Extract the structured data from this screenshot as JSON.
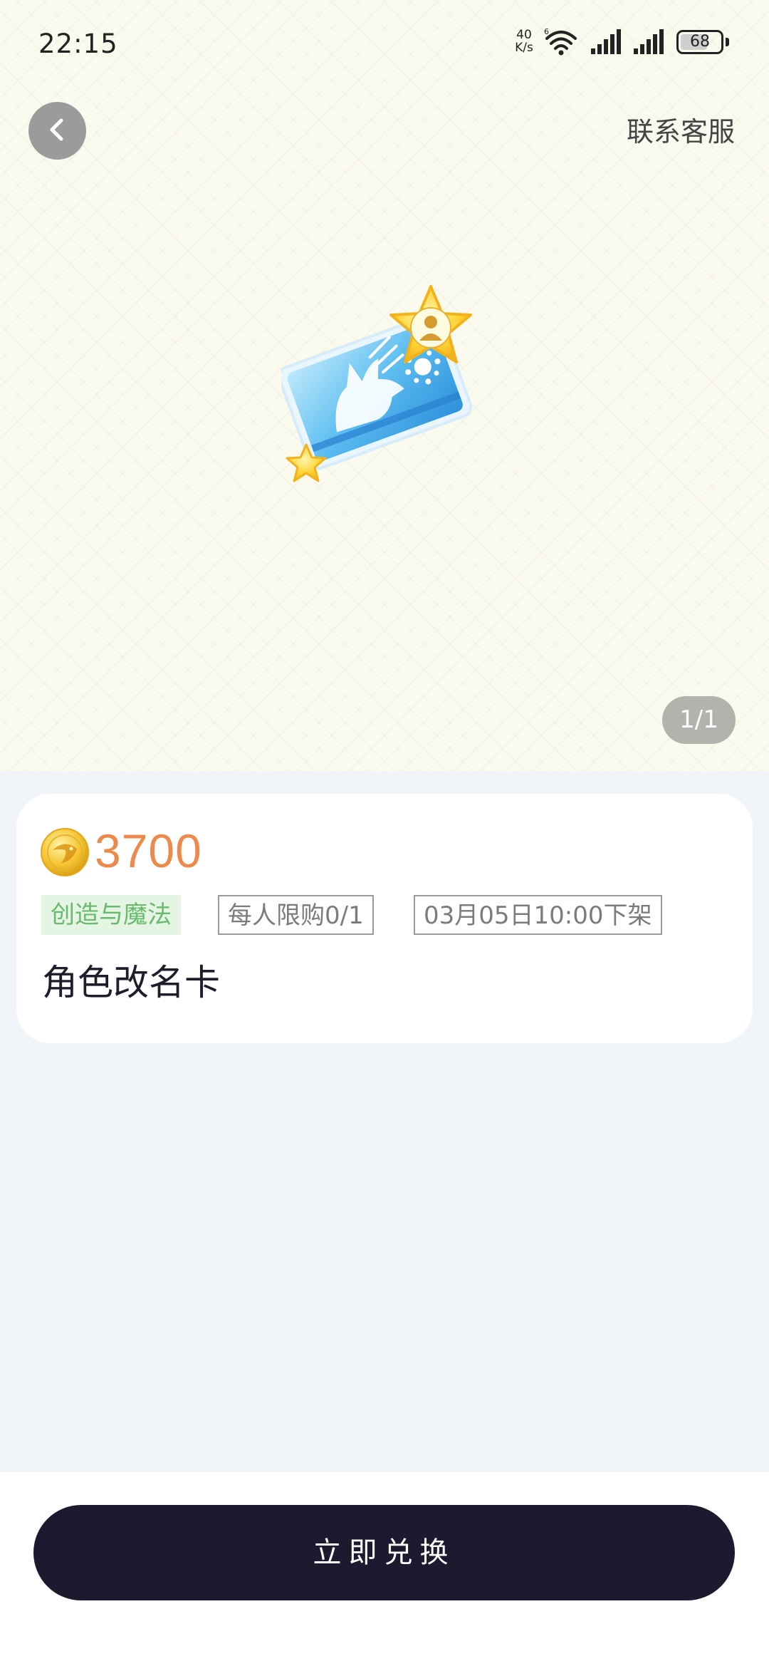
{
  "status_bar": {
    "time": "22:15",
    "net_speed_value": "40",
    "net_speed_unit": "K/s",
    "wifi_icon": "wifi-6-icon",
    "signal_icon": "signal-bars-icon",
    "battery_level": "68",
    "battery_fraction": 0.68
  },
  "nav": {
    "back_icon": "chevron-left-icon",
    "contact_label": "联系客服"
  },
  "gallery": {
    "image_icon": "rename-card-icon",
    "counter": "1/1"
  },
  "product": {
    "currency_icon": "gold-coin-icon",
    "price": "3700",
    "category_tag": "创造与魔法",
    "limit_tag": "每人限购0/1",
    "offshelf_tag": "03月05日10:00下架",
    "name": "角色改名卡"
  },
  "actions": {
    "redeem_label": "立即兑换"
  },
  "colors": {
    "price": "#ec8a4b",
    "category_text": "#69ba6d",
    "category_bg": "#e5f5e3",
    "button_bg": "#1b1a2e",
    "page_bg": "#f1f5f9",
    "hero_bg": "#fbfaef"
  }
}
